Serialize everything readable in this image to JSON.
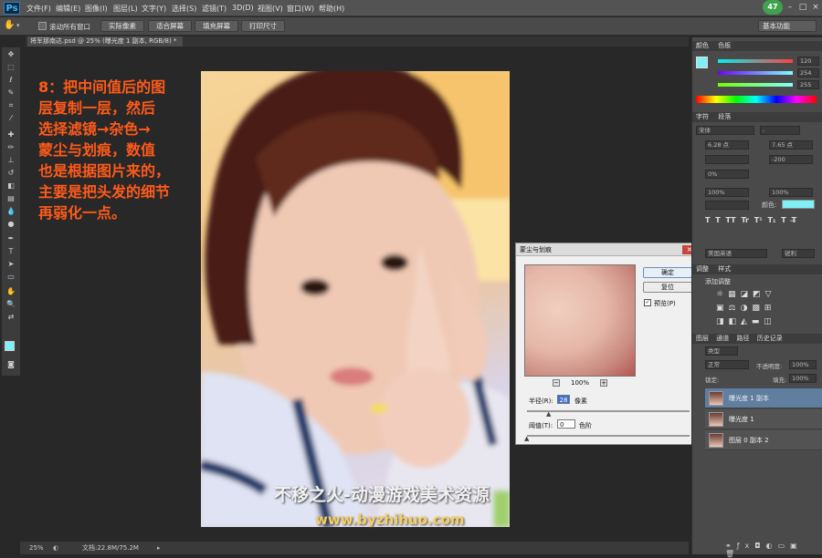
{
  "app": {
    "logo": "Ps",
    "notification_count": "47"
  },
  "menu": [
    "文件(F)",
    "编辑(E)",
    "图像(I)",
    "图层(L)",
    "文字(Y)",
    "选择(S)",
    "滤镜(T)",
    "3D(D)",
    "视图(V)",
    "窗口(W)",
    "帮助(H)"
  ],
  "options": {
    "scroll_all": "滚动所有窗口",
    "buttons": [
      "实际像素",
      "适合屏幕",
      "填充屏幕",
      "打印尺寸"
    ],
    "workspace": "基本功能"
  },
  "document": {
    "tab": "将军那南达.psd @ 25% (曝光度 1 副本, RGB/8) *"
  },
  "caption": [
    "8：把中间值后的图",
    "层复制一层，然后",
    "选择滤镜→杂色→",
    "蒙尘与划痕，数值",
    "也是根据图片来的，",
    "主要是把头发的细节",
    "再弱化一点。"
  ],
  "watermark": {
    "line1": "不移之火-动漫游戏美术资源",
    "line2": "www.byzhihuo.com"
  },
  "status": {
    "zoom": "25%",
    "doc": "文档:22.8M/75.2M"
  },
  "dialog": {
    "title": "蒙尘与划痕",
    "ok": "确定",
    "reset": "复位",
    "preview_check": "✓",
    "preview_label": "预览(P)",
    "zoom_minus": "−",
    "zoom_plus": "+",
    "zoom": "100%",
    "radius_label": "半径(R):",
    "radius_value": "28",
    "radius_unit": "像素",
    "threshold_label": "阈值(T):",
    "threshold_value": "0",
    "threshold_unit": "色阶"
  },
  "color_panel": {
    "tabs": [
      "颜色",
      "色板"
    ],
    "r": "120",
    "g": "254",
    "b": "255",
    "fg_color": "#7ff0f6",
    "bg_color": "#e0542c"
  },
  "char_panel": {
    "tabs": [
      "字符",
      "段落"
    ],
    "font": "宋体",
    "style": "-",
    "size": "6.28 点",
    "leading": "7.65 点",
    "tracking": "-200",
    "scale_pct": "0%",
    "vscale": "100%",
    "hscale": "100%",
    "color_label": "颜色:",
    "lang": "美国英语",
    "aa": "锐利",
    "styles": [
      "T",
      "T",
      "TT",
      "Tr",
      "T¹",
      "T₁",
      "T",
      "T̶"
    ]
  },
  "adjust_panel": {
    "tabs": [
      "调整",
      "样式"
    ],
    "title": "添加调整"
  },
  "layers_panel": {
    "tabs": [
      "图层",
      "通道",
      "路径",
      "历史记录"
    ],
    "kind": "类型",
    "blend": "正常",
    "opacity_label": "不透明度:",
    "opacity": "100%",
    "fill_label": "填充:",
    "fill": "100%",
    "lock_label": "锁定:",
    "layers": [
      {
        "name": "曝光度 1 副本",
        "selected": true
      },
      {
        "name": "曝光度 1",
        "selected": false
      },
      {
        "name": "图层 0 副本 2",
        "selected": false
      }
    ]
  }
}
